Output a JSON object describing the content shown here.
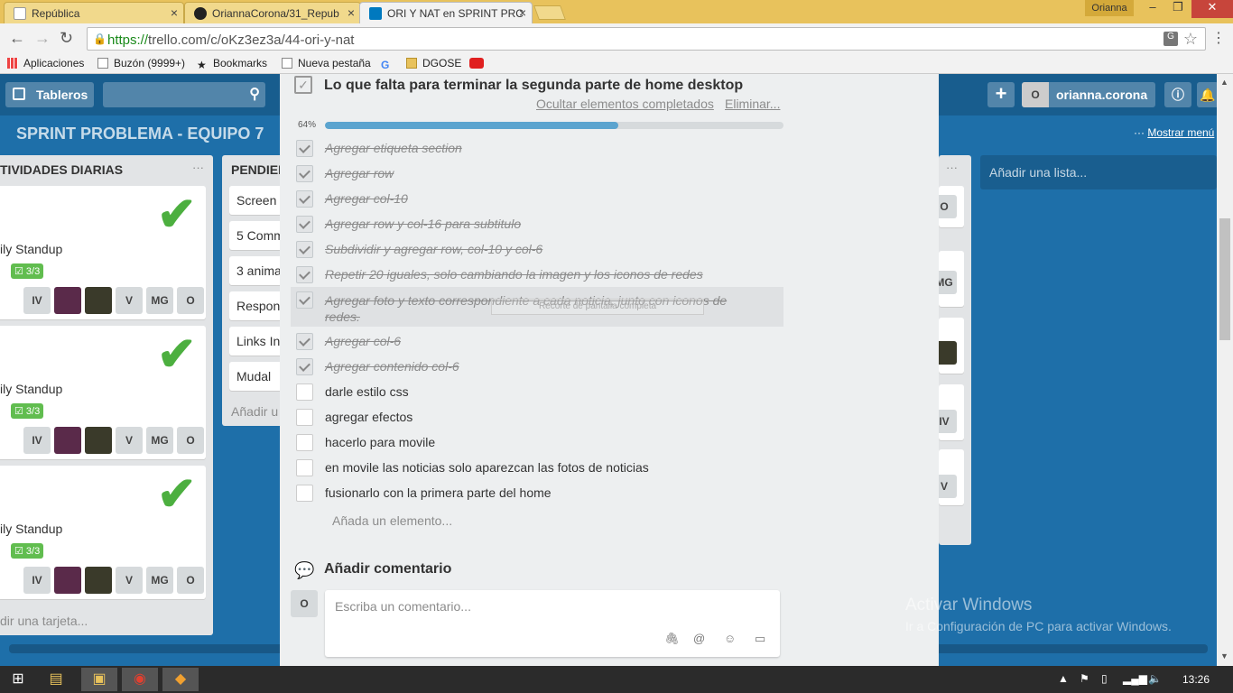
{
  "browser": {
    "tabs": [
      {
        "title": "República"
      },
      {
        "title": "OriannaCorona/31_Repub"
      },
      {
        "title": "ORI Y NAT en SPRINT PRC"
      }
    ],
    "user": "Orianna",
    "url_scheme": "https://",
    "url_rest": "trello.com/c/oKz3ez3a/44-ori-y-nat",
    "bookmarks": [
      "Aplicaciones",
      "Buzón (9999+)",
      "Bookmarks",
      "Nueva pestaña",
      "DGOSE"
    ]
  },
  "board": {
    "header": {
      "boards_btn": "Tableros",
      "username": "orianna.corona",
      "avatar": "O"
    },
    "title": "SPRINT PROBLEMA - EQUIPO 7",
    "show_menu": "Mostrar menú",
    "lists": [
      {
        "title": "TIVIDADES DIARIAS",
        "cards": [
          {
            "text": "ily Standup",
            "badge": "3/3"
          },
          {
            "text": "ily Standup",
            "badge": "3/3"
          },
          {
            "text": "ily Standup",
            "badge": "3/3"
          }
        ],
        "members": [
          "IV",
          "V",
          "MG",
          "O"
        ],
        "add_card": "dir una tarjeta..."
      },
      {
        "title": "PENDIEN",
        "cards": [
          "Screen",
          "5 Comm",
          "3 anima",
          "Respon",
          "Links In",
          "Mudal"
        ],
        "add_card": "Añadir u"
      }
    ],
    "add_list": "Añadir una lista...",
    "right_members": [
      "O",
      "MG",
      "IV",
      "V"
    ]
  },
  "modal": {
    "checklist_title": "Lo que falta para terminar la segunda parte de home desktop",
    "hide_completed": "Ocultar elementos completados",
    "delete": "Eliminar...",
    "progress_label": "64%",
    "progress": 0.64,
    "items": [
      {
        "text": "Agregar etiqueta section",
        "done": true
      },
      {
        "text": "Agregar row",
        "done": true
      },
      {
        "text": "Agregar col-10",
        "done": true
      },
      {
        "text": "Agregar row y col-16 para subtitulo",
        "done": true
      },
      {
        "text": "Subdividir y agregar row, col-10 y col-6",
        "done": true
      },
      {
        "text": "Repetir 20 iguales, solo cambiando la imagen y los iconos de redes",
        "done": true
      },
      {
        "text": "Agregar foto y texto correspondiente a cada noticia, junto con iconos de redes.",
        "done": true
      },
      {
        "text": "Agregar col-6",
        "done": true
      },
      {
        "text": "Agregar contenido col-6",
        "done": true
      },
      {
        "text": "darle estilo css",
        "done": false
      },
      {
        "text": "agregar efectos",
        "done": false
      },
      {
        "text": "hacerlo para movile",
        "done": false
      },
      {
        "text": "en movile las noticias solo aparezcan las fotos de noticias",
        "done": false
      },
      {
        "text": "fusionarlo con la primera parte del home",
        "done": false
      }
    ],
    "snip_overlay": "Recorte de pantalla completa",
    "add_item": "Añada un elemento...",
    "comment_title": "Añadir comentario",
    "comment_avatar": "O",
    "comment_placeholder": "Escriba un comentario..."
  },
  "watermark": {
    "line1": "Activar Windows",
    "line2": "Ir a Configuración de PC para activar Windows."
  },
  "taskbar": {
    "clock": "13:26"
  },
  "colors": {
    "board_bg": "#1e6fa9",
    "progress": "#5ba4cf",
    "label_green": "#61bd4f"
  }
}
